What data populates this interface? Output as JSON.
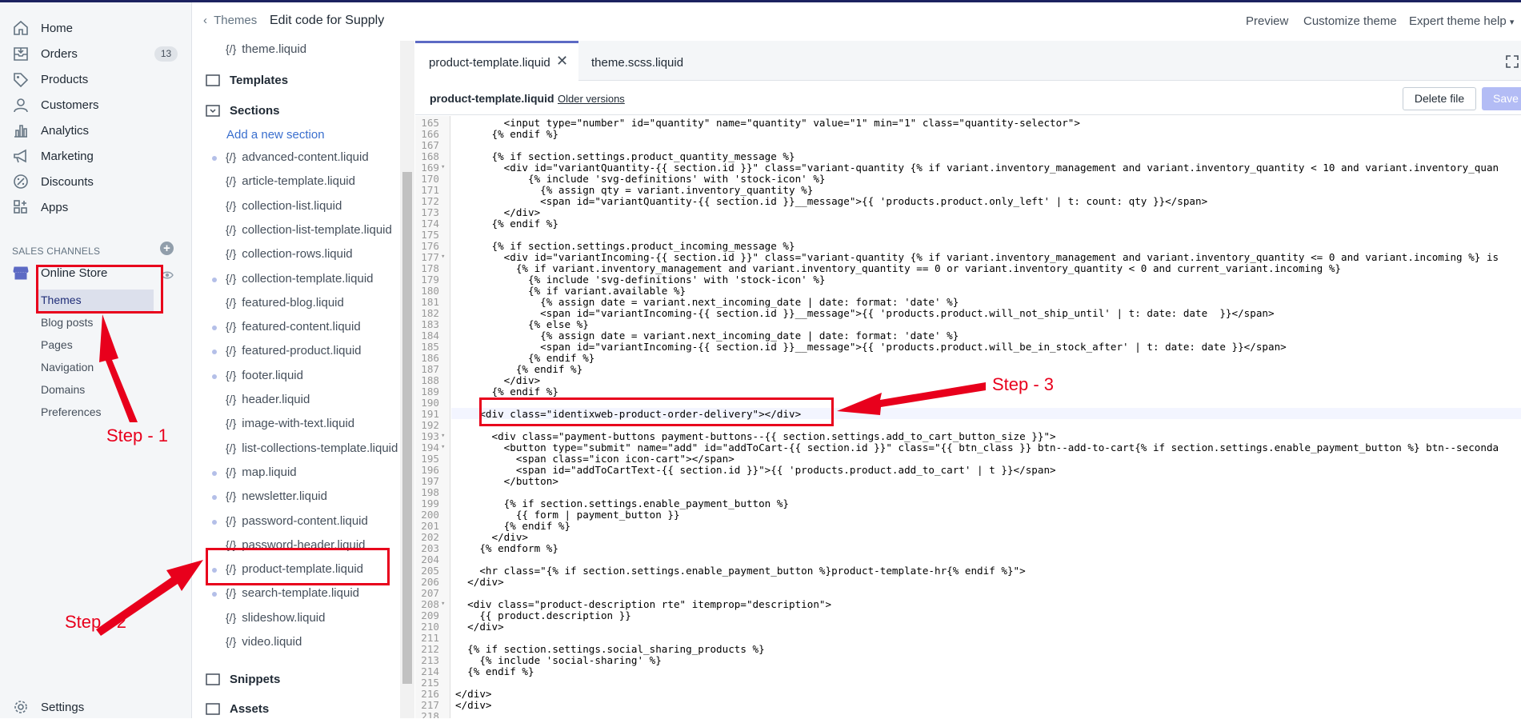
{
  "nav": {
    "items": [
      {
        "label": "Home",
        "icon": "home-icon"
      },
      {
        "label": "Orders",
        "icon": "orders-icon",
        "badge": "13"
      },
      {
        "label": "Products",
        "icon": "tag-icon"
      },
      {
        "label": "Customers",
        "icon": "customers-icon"
      },
      {
        "label": "Analytics",
        "icon": "analytics-icon"
      },
      {
        "label": "Marketing",
        "icon": "megaphone-icon"
      },
      {
        "label": "Discounts",
        "icon": "discount-icon"
      },
      {
        "label": "Apps",
        "icon": "apps-icon"
      }
    ],
    "sales_channels_heading": "SALES CHANNELS",
    "online_store": "Online Store",
    "sub_items": [
      "Themes",
      "Blog posts",
      "Pages",
      "Navigation",
      "Domains",
      "Preferences"
    ],
    "settings": "Settings"
  },
  "header": {
    "back": "Themes",
    "title": "Edit code for Supply",
    "links": [
      "Preview",
      "Customize theme",
      "Expert theme help"
    ]
  },
  "tree": {
    "top_file": "theme.liquid",
    "folder_templates": "Templates",
    "folder_sections": "Sections",
    "add_section": "Add a new section",
    "files": [
      {
        "name": "advanced-content.liquid",
        "dot": true
      },
      {
        "name": "article-template.liquid",
        "dot": false
      },
      {
        "name": "collection-list.liquid",
        "dot": false
      },
      {
        "name": "collection-list-template.liquid",
        "dot": false
      },
      {
        "name": "collection-rows.liquid",
        "dot": false
      },
      {
        "name": "collection-template.liquid",
        "dot": true
      },
      {
        "name": "featured-blog.liquid",
        "dot": false
      },
      {
        "name": "featured-content.liquid",
        "dot": true
      },
      {
        "name": "featured-product.liquid",
        "dot": true
      },
      {
        "name": "footer.liquid",
        "dot": true
      },
      {
        "name": "header.liquid",
        "dot": false
      },
      {
        "name": "image-with-text.liquid",
        "dot": false
      },
      {
        "name": "list-collections-template.liquid",
        "dot": false
      },
      {
        "name": "map.liquid",
        "dot": true
      },
      {
        "name": "newsletter.liquid",
        "dot": true
      },
      {
        "name": "password-content.liquid",
        "dot": true
      },
      {
        "name": "password-header.liquid",
        "dot": false
      },
      {
        "name": "product-template.liquid",
        "dot": true
      },
      {
        "name": "search-template.liquid",
        "dot": true
      },
      {
        "name": "slideshow.liquid",
        "dot": false
      },
      {
        "name": "video.liquid",
        "dot": false
      }
    ],
    "folder_snippets": "Snippets",
    "folder_assets": "Assets"
  },
  "editor": {
    "tabs": [
      "product-template.liquid",
      "theme.scss.liquid"
    ],
    "file_name": "product-template.liquid",
    "older_versions": "Older versions",
    "delete_label": "Delete file",
    "save_label": "Save",
    "lines": [
      {
        "n": "165",
        "t": "        <input type=\"number\" id=\"quantity\" name=\"quantity\" value=\"1\" min=\"1\" class=\"quantity-selector\">"
      },
      {
        "n": "166",
        "t": "      {% endif %}"
      },
      {
        "n": "167",
        "t": ""
      },
      {
        "n": "168",
        "t": "      {% if section.settings.product_quantity_message %}"
      },
      {
        "n": "169",
        "t": "        <div id=\"variantQuantity-{{ section.id }}\" class=\"variant-quantity {% if variant.inventory_management and variant.inventory_quantity < 10 and variant.inventory_quan",
        "f": true
      },
      {
        "n": "170",
        "t": "            {% include 'svg-definitions' with 'stock-icon' %}"
      },
      {
        "n": "171",
        "t": "              {% assign qty = variant.inventory_quantity %}"
      },
      {
        "n": "172",
        "t": "              <span id=\"variantQuantity-{{ section.id }}__message\">{{ 'products.product.only_left' | t: count: qty }}</span>"
      },
      {
        "n": "173",
        "t": "        </div>"
      },
      {
        "n": "174",
        "t": "      {% endif %}"
      },
      {
        "n": "175",
        "t": ""
      },
      {
        "n": "176",
        "t": "      {% if section.settings.product_incoming_message %}"
      },
      {
        "n": "177",
        "t": "        <div id=\"variantIncoming-{{ section.id }}\" class=\"variant-quantity {% if variant.inventory_management and variant.inventory_quantity <= 0 and variant.incoming %} is",
        "f": true
      },
      {
        "n": "178",
        "t": "          {% if variant.inventory_management and variant.inventory_quantity == 0 or variant.inventory_quantity < 0 and current_variant.incoming %}"
      },
      {
        "n": "179",
        "t": "            {% include 'svg-definitions' with 'stock-icon' %}"
      },
      {
        "n": "180",
        "t": "            {% if variant.available %}"
      },
      {
        "n": "181",
        "t": "              {% assign date = variant.next_incoming_date | date: format: 'date' %}"
      },
      {
        "n": "182",
        "t": "              <span id=\"variantIncoming-{{ section.id }}__message\">{{ 'products.product.will_not_ship_until' | t: date: date  }}</span>"
      },
      {
        "n": "183",
        "t": "            {% else %}"
      },
      {
        "n": "184",
        "t": "              {% assign date = variant.next_incoming_date | date: format: 'date' %}"
      },
      {
        "n": "185",
        "t": "              <span id=\"variantIncoming-{{ section.id }}__message\">{{ 'products.product.will_be_in_stock_after' | t: date: date }}</span>"
      },
      {
        "n": "186",
        "t": "            {% endif %}"
      },
      {
        "n": "187",
        "t": "          {% endif %}"
      },
      {
        "n": "188",
        "t": "        </div>"
      },
      {
        "n": "189",
        "t": "      {% endif %}"
      },
      {
        "n": "190",
        "t": ""
      },
      {
        "n": "191",
        "t": "    <div class=\"identixweb-product-order-delivery\"></div>",
        "cur": true
      },
      {
        "n": "192",
        "t": ""
      },
      {
        "n": "193",
        "t": "      <div class=\"payment-buttons payment-buttons--{{ section.settings.add_to_cart_button_size }}\">",
        "f": true
      },
      {
        "n": "194",
        "t": "        <button type=\"submit\" name=\"add\" id=\"addToCart-{{ section.id }}\" class=\"{{ btn_class }} btn--add-to-cart{% if section.settings.enable_payment_button %} btn--seconda",
        "f": true
      },
      {
        "n": "195",
        "t": "          <span class=\"icon icon-cart\"></span>"
      },
      {
        "n": "196",
        "t": "          <span id=\"addToCartText-{{ section.id }}\">{{ 'products.product.add_to_cart' | t }}</span>"
      },
      {
        "n": "197",
        "t": "        </button>"
      },
      {
        "n": "198",
        "t": ""
      },
      {
        "n": "199",
        "t": "        {% if section.settings.enable_payment_button %}"
      },
      {
        "n": "200",
        "t": "          {{ form | payment_button }}"
      },
      {
        "n": "201",
        "t": "        {% endif %}"
      },
      {
        "n": "202",
        "t": "      </div>"
      },
      {
        "n": "203",
        "t": "    {% endform %}"
      },
      {
        "n": "204",
        "t": ""
      },
      {
        "n": "205",
        "t": "    <hr class=\"{% if section.settings.enable_payment_button %}product-template-hr{% endif %}\">"
      },
      {
        "n": "206",
        "t": "  </div>"
      },
      {
        "n": "207",
        "t": ""
      },
      {
        "n": "208",
        "t": "  <div class=\"product-description rte\" itemprop=\"description\">",
        "f": true
      },
      {
        "n": "209",
        "t": "    {{ product.description }}"
      },
      {
        "n": "210",
        "t": "  </div>"
      },
      {
        "n": "211",
        "t": ""
      },
      {
        "n": "212",
        "t": "  {% if section.settings.social_sharing_products %}"
      },
      {
        "n": "213",
        "t": "    {% include 'social-sharing' %}"
      },
      {
        "n": "214",
        "t": "  {% endif %}"
      },
      {
        "n": "215",
        "t": ""
      },
      {
        "n": "216",
        "t": "</div>"
      },
      {
        "n": "217",
        "t": "</div>"
      },
      {
        "n": "218",
        "t": ""
      }
    ]
  },
  "annotations": {
    "step1": "Step - 1",
    "step2": "Step - 2",
    "step3": "Step - 3"
  },
  "colors": {
    "annotation_red": "#e8001c",
    "accent": "#5c6ac4",
    "link": "#3a6fce"
  }
}
